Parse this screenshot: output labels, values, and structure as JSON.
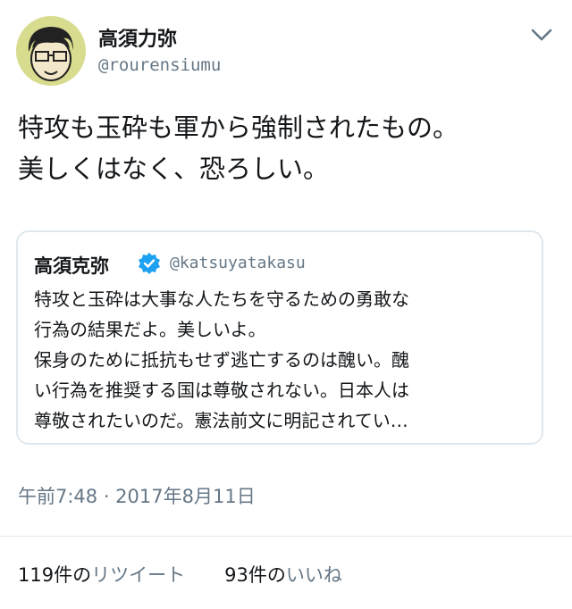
{
  "user": {
    "display_name": "高須力弥",
    "handle": "@rourensiumu"
  },
  "tweet": {
    "lines": [
      "特攻も玉砕も軍から強制されたもの。",
      "美しくはなく、恐ろしい。"
    ]
  },
  "quoted_tweet": {
    "display_name": "高須克弥",
    "handle": "@katsuyatakasu",
    "verified": true,
    "lines": [
      "特攻と玉砕は大事な人たちを守るための勇敢な",
      "行為の結果だよ。美しいよ。",
      "保身のために抵抗もせず逃亡するのは醜い。醜",
      "い行為を推奨する国は尊敬されない。日本人は",
      "尊敬されたいのだ。憲法前文に明記されてい…"
    ]
  },
  "timestamp": "午前7:48 · 2017年8月11日",
  "stats": {
    "retweets_count": "119件の",
    "retweets_label": "リツイート",
    "likes_count": "93件の",
    "likes_label": "いいね"
  },
  "colors": {
    "text": "#14171a",
    "secondary": "#657786",
    "border": "#e1e8ed",
    "verified": "#1da1f2",
    "avatar_bg": "#d8dc8e"
  },
  "icons": {
    "menu": "chevron-down-icon",
    "verified": "verified-badge-icon"
  }
}
